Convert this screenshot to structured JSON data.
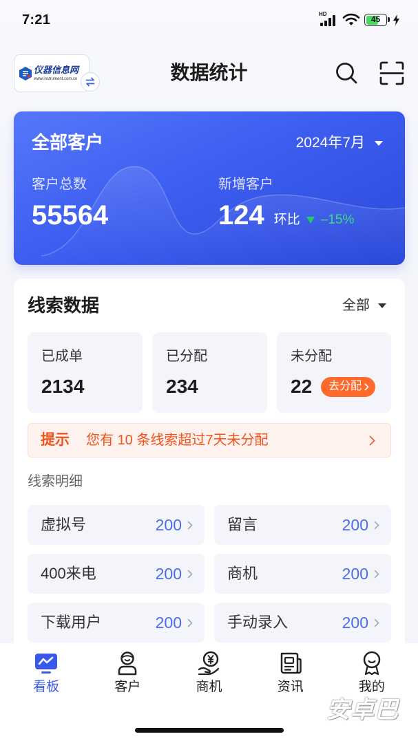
{
  "status_bar": {
    "time": "7:21",
    "network": "HD",
    "battery": "45",
    "icons": [
      "signal-icon",
      "wifi-icon",
      "battery-icon",
      "charging-icon"
    ]
  },
  "header": {
    "logo": {
      "name": "仪器信息网",
      "url": "www.instrument.com.cn"
    },
    "title": "数据统计",
    "icons": {
      "switch": "swap-icon",
      "search": "search-icon",
      "scan": "scan-icon"
    }
  },
  "customer_card": {
    "title": "全部客户",
    "period": "2024年7月",
    "total": {
      "label": "客户总数",
      "value": "55564"
    },
    "new": {
      "label": "新增客户",
      "value": "124",
      "compare_label": "环比",
      "compare_value": "–15%",
      "trend_icon": "triangle-down-icon"
    }
  },
  "leads": {
    "title": "线索数据",
    "filter": "全部",
    "stats": [
      {
        "label": "已成单",
        "value": "2134"
      },
      {
        "label": "已分配",
        "value": "234"
      },
      {
        "label": "未分配",
        "value": "22",
        "action": "去分配"
      }
    ],
    "tip": {
      "label": "提示",
      "message": "您有 10 条线索超过7天未分配"
    },
    "detail_title": "线索明细",
    "details": [
      {
        "label": "虚拟号",
        "value": "200"
      },
      {
        "label": "留言",
        "value": "200"
      },
      {
        "label": "400来电",
        "value": "200"
      },
      {
        "label": "商机",
        "value": "200"
      },
      {
        "label": "下载用户",
        "value": "200"
      },
      {
        "label": "手动录入",
        "value": "200"
      }
    ]
  },
  "nav": [
    {
      "label": "看板",
      "icon": "dashboard-icon",
      "active": true
    },
    {
      "label": "客户",
      "icon": "customer-icon",
      "active": false
    },
    {
      "label": "商机",
      "icon": "opportunity-icon",
      "active": false
    },
    {
      "label": "资讯",
      "icon": "news-icon",
      "active": false
    },
    {
      "label": "我的",
      "icon": "profile-icon",
      "active": false
    }
  ],
  "watermark": "安卓巴",
  "colors": {
    "accent": "#3858ec",
    "card_gradient_start": "#5677fb",
    "card_gradient_end": "#2b49da",
    "assign_button": "#ff6a2c",
    "tip_text": "#f2521c",
    "tip_background": "#fef2ee",
    "detail_value": "#4b6cf0",
    "decrease": "#23cc5e",
    "tile_background": "#f3f5fa"
  }
}
